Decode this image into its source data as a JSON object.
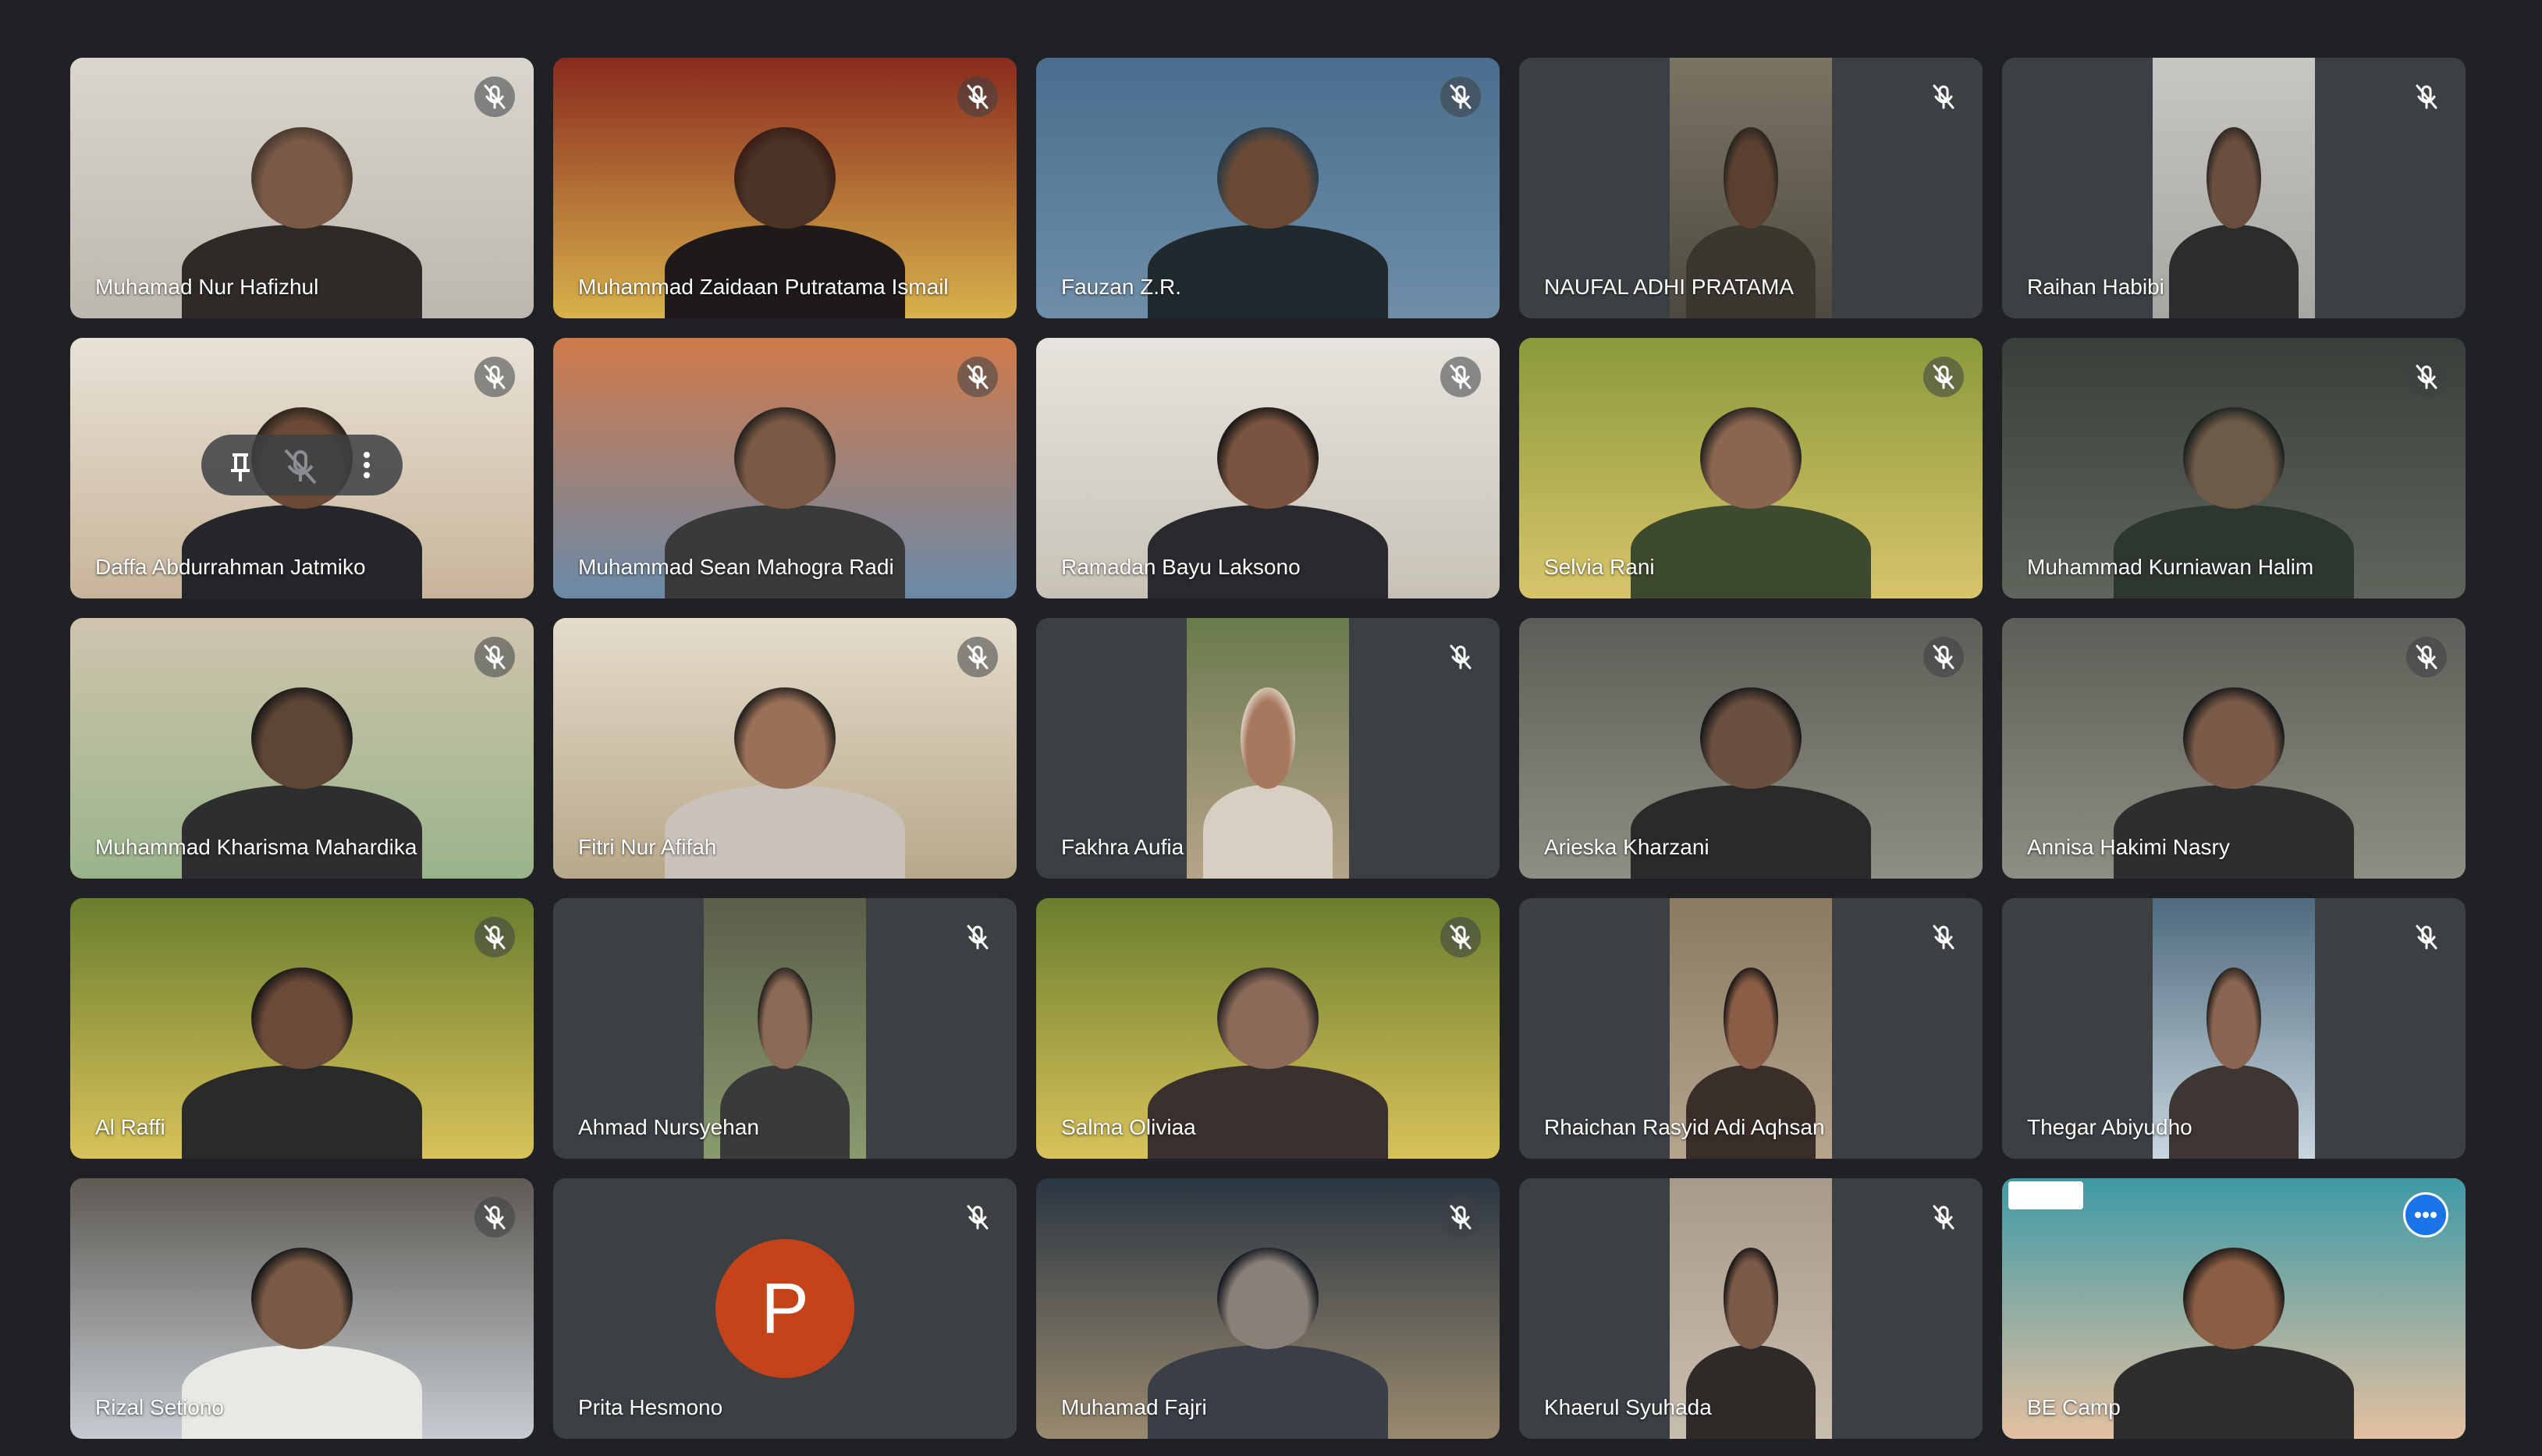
{
  "meeting": {
    "participants": [
      {
        "name": "Muhamad Nur Hafizhul",
        "muted": true,
        "scene": [
          "#d9d6cf",
          "#bdb8ad",
          "#4a3a30",
          "#2e2a28",
          "#7a5a45"
        ]
      },
      {
        "name": "Muhammad Zaidaan Putratama Ismail",
        "muted": true,
        "scene": [
          "#8a2a1e",
          "#d8b24c",
          "#3a1e18",
          "#1e1a1a",
          "#4a3426"
        ]
      },
      {
        "name": "Fauzan Z.R.",
        "muted": true,
        "scene": [
          "#4a6e8e",
          "#6e8ea8",
          "#2a3a46",
          "#202a2e",
          "#6a4a35"
        ]
      },
      {
        "name": "NAUFAL ADHI PRATAMA",
        "muted": true,
        "scene": [
          "#7a7464",
          "#4e4a40",
          "#2a2620",
          "#3a3630",
          "#5a4030"
        ]
      },
      {
        "name": "Raihan Habibi",
        "muted": true,
        "scene": [
          "#c8c6c0",
          "#a8a6a0",
          "#302a26",
          "#2a2c2e",
          "#6a4e3e"
        ]
      },
      {
        "name": "Daffa Abdurrahman Jatmiko",
        "muted": true,
        "scene": [
          "#e8e2d6",
          "#c8b49a",
          "#2e2620",
          "#24262a",
          "#6a4a36"
        ]
      },
      {
        "name": "Muhammad Sean Mahogra Radi",
        "muted": true,
        "scene": [
          "#d07a4a",
          "#6a8aa8",
          "#2a2420",
          "#3a3a3a",
          "#7a5a46"
        ]
      },
      {
        "name": "Ramadan Bayu Laksono",
        "muted": true,
        "scene": [
          "#e6e4de",
          "#c8c2b6",
          "#1e1a18",
          "#2a2a2e",
          "#7a5440"
        ]
      },
      {
        "name": "Selvia Rani",
        "muted": true,
        "scene": [
          "#8a9a3a",
          "#d8c46a",
          "#2a2420",
          "#3e4a2e",
          "#8a6650"
        ]
      },
      {
        "name": "Muhammad Kurniawan Halim",
        "muted": true,
        "scene": [
          "#3a3e3a",
          "#5e665c",
          "#1e2220",
          "#2e3630",
          "#6e5a48"
        ]
      },
      {
        "name": "Muhammad Kharisma Mahardika",
        "muted": true,
        "scene": [
          "#cfc4ae",
          "#9ab48a",
          "#1e1c1a",
          "#2e2e30",
          "#5e4636"
        ]
      },
      {
        "name": "Fitri Nur Afifah",
        "muted": true,
        "scene": [
          "#e4dccb",
          "#b8a88a",
          "#2a2420",
          "#c8c2ba",
          "#9a7058"
        ]
      },
      {
        "name": "Fakhra Aufia",
        "muted": true,
        "scene": [
          "#6a7a4e",
          "#b6a48a",
          "#d6c8b8",
          "#d8cec2",
          "#a8785e"
        ]
      },
      {
        "name": "Arieska Kharzani",
        "muted": true,
        "scene": [
          "#5e5e58",
          "#8e8e84",
          "#1a1a1a",
          "#2a2a2a",
          "#6a5040"
        ]
      },
      {
        "name": "Annisa Hakimi Nasry",
        "muted": true,
        "scene": [
          "#5e5e58",
          "#8e8e84",
          "#1a1a1a",
          "#2e2e2e",
          "#7a5a48"
        ]
      },
      {
        "name": "Al Raffi",
        "muted": true,
        "scene": [
          "#6a7e2e",
          "#d8c25a",
          "#1e1a18",
          "#2a2a2a",
          "#6a4a38"
        ]
      },
      {
        "name": "Ahmad Nursyehan",
        "muted": true,
        "scene": [
          "#5a5e4a",
          "#8a9a6e",
          "#2a2420",
          "#3a3a3a",
          "#8a6a54"
        ]
      },
      {
        "name": "Salma Oliviaa",
        "muted": true,
        "scene": [
          "#6a7e2e",
          "#d8c25a",
          "#2a2422",
          "#3a302e",
          "#8a6a58"
        ]
      },
      {
        "name": "Rhaichan Rasyid Adi Aqhsan",
        "muted": true,
        "scene": [
          "#8a7a62",
          "#b6a48e",
          "#1e1a18",
          "#3a2e28",
          "#8a5e46"
        ]
      },
      {
        "name": "Thegar Abiyudho",
        "muted": true,
        "scene": [
          "#4e6a7e",
          "#c8d6de",
          "#2a2420",
          "#3e3632",
          "#8a6652"
        ]
      },
      {
        "name": "Rizal Setiono",
        "muted": true,
        "scene": [
          "#5e5a54",
          "#c6ccd2",
          "#1a1a1a",
          "#e8e8e4",
          "#7a5a46"
        ]
      },
      {
        "name": "Prita Hesmono",
        "muted": true,
        "avatar_letter": "P"
      },
      {
        "name": "Muhamad Fajri",
        "muted": true,
        "scene": [
          "#2a3642",
          "#9a8a6e",
          "#1a1e24",
          "#3a3e46",
          "#8a8078"
        ]
      },
      {
        "name": "Khaerul Syuhada",
        "muted": true,
        "scene": [
          "#a89a8a",
          "#c8beb0",
          "#1e1a18",
          "#2e2a28",
          "#7a5a48"
        ]
      },
      {
        "name": "BE Camp",
        "muted": false,
        "active": true,
        "scene": [
          "#3e9aa6",
          "#e4c0a0",
          "#1e1a18",
          "#2e2e2e",
          "#8a5e44"
        ]
      }
    ]
  }
}
